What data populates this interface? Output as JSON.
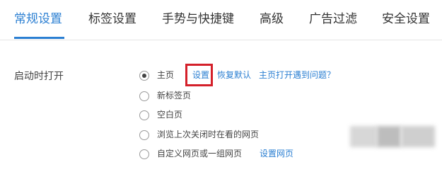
{
  "tabs": [
    {
      "label": "常规设置",
      "active": true
    },
    {
      "label": "标签设置",
      "active": false
    },
    {
      "label": "手势与快捷键",
      "active": false
    },
    {
      "label": "高级",
      "active": false
    },
    {
      "label": "广告过滤",
      "active": false
    },
    {
      "label": "安全设置",
      "active": false
    }
  ],
  "startup": {
    "label": "启动时打开",
    "options": [
      {
        "label": "主页",
        "checked": true
      },
      {
        "label": "新标签页",
        "checked": false
      },
      {
        "label": "空白页",
        "checked": false
      },
      {
        "label": "浏览上次关闭时在看的网页",
        "checked": false
      },
      {
        "label": "自定义网页或一组网页",
        "checked": false
      }
    ],
    "homepage_links": {
      "settings": "设置",
      "restore_default": "恢复默认",
      "help": "主页打开遇到问题？"
    },
    "custom_link": "设置网页"
  },
  "colors": {
    "accent": "#2b7fd2",
    "highlight": "#d4202a",
    "text": "#333333"
  }
}
